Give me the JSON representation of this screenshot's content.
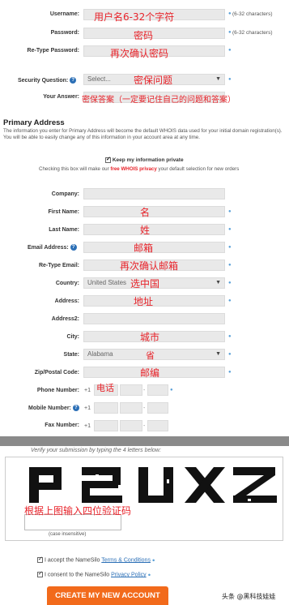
{
  "labels": {
    "username": "Username:",
    "password": "Password:",
    "retype_password": "Re-Type Password:",
    "security_question": "Security Question:",
    "your_answer": "Your Answer:",
    "company": "Company:",
    "first_name": "First Name:",
    "last_name": "Last Name:",
    "email": "Email Address:",
    "retype_email": "Re-Type Email:",
    "country": "Country:",
    "address": "Address:",
    "address2": "Address2:",
    "city": "City:",
    "state": "State:",
    "zip": "Zip/Postal Code:",
    "phone": "Phone Number:",
    "mobile": "Mobile Number:",
    "fax": "Fax Number:"
  },
  "hints": {
    "username": "(6-32 characters)",
    "password": "(6-32 characters)"
  },
  "annotations": {
    "username": "用户名6-32个字符",
    "password": "密码",
    "retype_password": "再次确认密码",
    "security_question": "密保问题",
    "your_answer": "密保答案（一定要记住自己的问题和答案）",
    "first_name": "名",
    "last_name": "姓",
    "email": "邮箱",
    "retype_email": "再次确认邮箱",
    "country": "选中国",
    "address": "地址",
    "city": "城市",
    "state": "省",
    "zip": "邮编",
    "phone": "电话",
    "captcha": "根据上图输入四位验证码"
  },
  "security_select_value": "Select...",
  "country_value": "United States",
  "state_value": "Alabama",
  "phone_prefix": "+1",
  "primary_address": {
    "title": "Primary Address",
    "desc": "The information you enter for Primary Address will become the default WHOIS data used for your initial domain registration(s). You will be able to easily change any of this information in your account area at any time.",
    "keep_private": "Keep my information private",
    "privacy_note_pre": "Checking this box will make our ",
    "privacy_link": "free WHOIS privacy",
    "privacy_note_post": " your default selection for new orders"
  },
  "captcha": {
    "verify_text": "Verify your submission by typing the 4 letters below:",
    "case_note": "(case insensitive)"
  },
  "terms": {
    "accept_pre": "I accept the NameSilo ",
    "accept_link": "Terms & Conditions",
    "consent_pre": "I consent to the NameSilo ",
    "consent_link": "Privacy Policy"
  },
  "create_button": "CREATE MY NEW ACCOUNT",
  "watermark": "头条 @黑科技娃娃",
  "colors": {
    "annotation_red": "#e8232a",
    "button_orange": "#f26a1b",
    "link_blue": "#2b6fb6",
    "input_gray": "#e9e9e9"
  }
}
